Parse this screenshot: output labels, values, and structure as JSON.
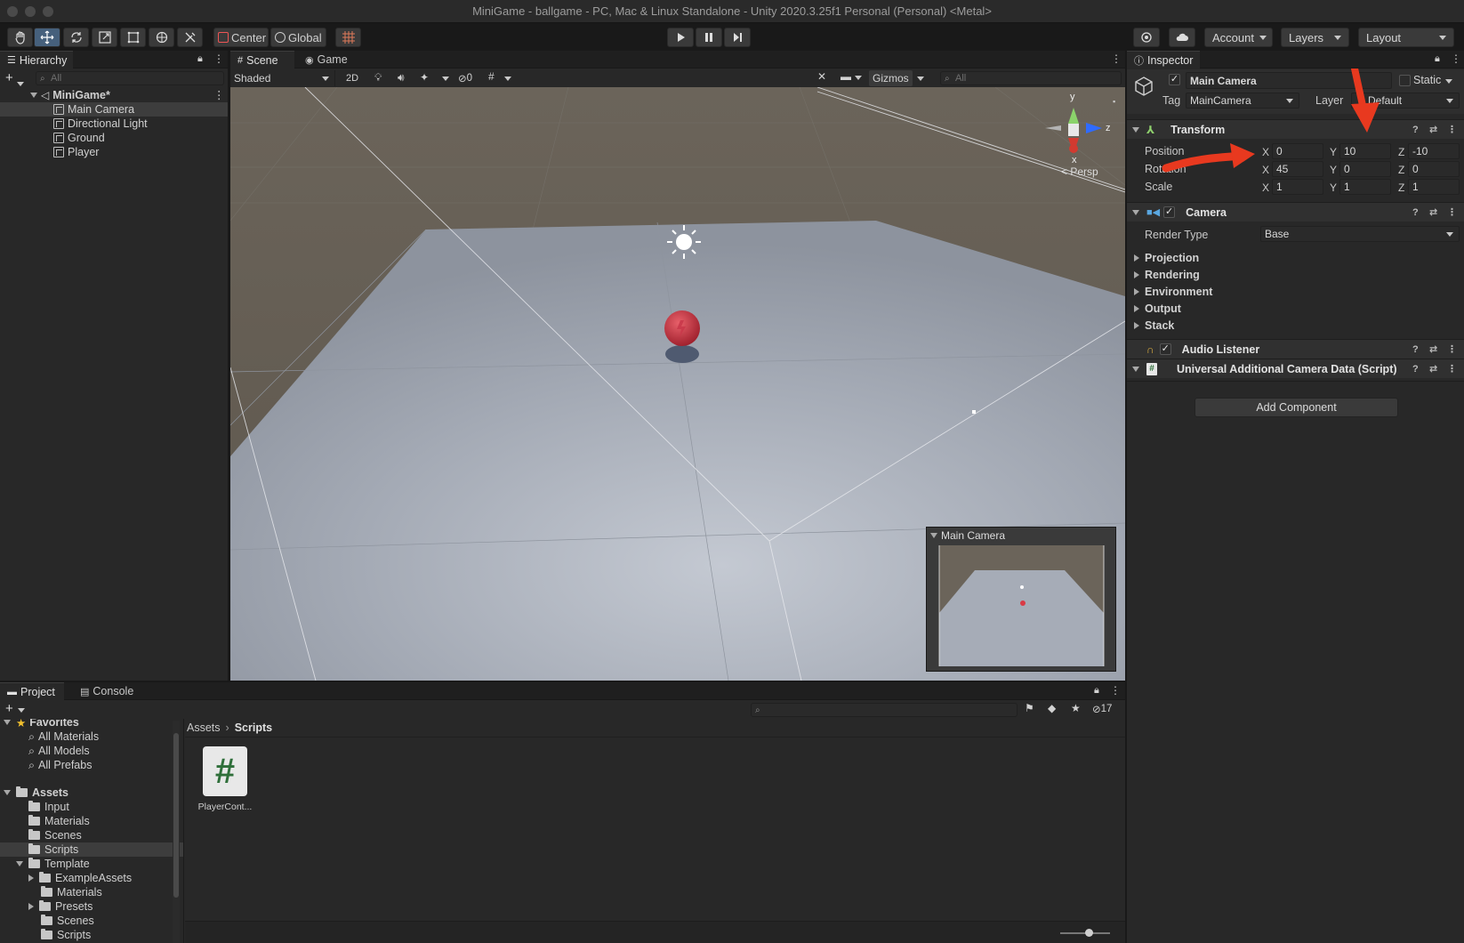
{
  "window": {
    "title": "MiniGame - ballgame - PC, Mac & Linux Standalone - Unity 2020.3.25f1 Personal (Personal) <Metal>"
  },
  "toolbar": {
    "pivot_label": "Center",
    "space_label": "Global",
    "account_label": "Account",
    "layers_label": "Layers",
    "layout_label": "Layout"
  },
  "hierarchy": {
    "tab_label": "Hierarchy",
    "search_placeholder": "All",
    "scene_name": "MiniGame*",
    "items": [
      {
        "label": "Main Camera"
      },
      {
        "label": "Directional Light"
      },
      {
        "label": "Ground"
      },
      {
        "label": "Player"
      }
    ]
  },
  "scene": {
    "tabs": [
      {
        "label": "Scene"
      },
      {
        "label": "Game"
      }
    ],
    "draw_mode": "Shaded",
    "mode_2d": "2D",
    "hidden_count": "0",
    "gizmos_label": "Gizmos",
    "search_placeholder": "All",
    "gizmo_axes": {
      "y": "y",
      "z": "z",
      "x": "x"
    },
    "persp_label": "Persp",
    "camera_preview_title": "Main Camera"
  },
  "inspector": {
    "tab_label": "Inspector",
    "object_name": "Main Camera",
    "static_label": "Static",
    "tag_label": "Tag",
    "tag_value": "MainCamera",
    "layer_label": "Layer",
    "layer_value": "Default",
    "transform": {
      "title": "Transform",
      "position_label": "Position",
      "rotation_label": "Rotation",
      "scale_label": "Scale",
      "axis_x": "X",
      "axis_y": "Y",
      "axis_z": "Z",
      "position": {
        "x": "0",
        "y": "10",
        "z": "-10"
      },
      "rotation": {
        "x": "45",
        "y": "0",
        "z": "0"
      },
      "scale": {
        "x": "1",
        "y": "1",
        "z": "1"
      }
    },
    "camera": {
      "title": "Camera",
      "render_type_label": "Render Type",
      "render_type_value": "Base",
      "sections": [
        {
          "label": "Projection"
        },
        {
          "label": "Rendering"
        },
        {
          "label": "Environment"
        },
        {
          "label": "Output"
        },
        {
          "label": "Stack"
        }
      ]
    },
    "audio_listener": {
      "title": "Audio Listener"
    },
    "urp_data": {
      "title": "Universal Additional Camera Data (Script)"
    },
    "add_component_label": "Add Component"
  },
  "project": {
    "tabs": [
      {
        "label": "Project"
      },
      {
        "label": "Console"
      }
    ],
    "hidden_count": "17",
    "favorites_label": "Favorites",
    "favorites": [
      {
        "label": "All Materials"
      },
      {
        "label": "All Models"
      },
      {
        "label": "All Prefabs"
      }
    ],
    "assets_label": "Assets",
    "asset_folders": [
      {
        "label": "Input"
      },
      {
        "label": "Materials"
      },
      {
        "label": "Scenes"
      },
      {
        "label": "Scripts"
      }
    ],
    "template_label": "Template",
    "template_children": [
      {
        "label": "ExampleAssets"
      },
      {
        "label": "Materials"
      },
      {
        "label": "Presets"
      },
      {
        "label": "Scenes"
      },
      {
        "label": "Scripts"
      }
    ],
    "breadcrumb": {
      "root": "Assets",
      "current": "Scripts"
    },
    "files": [
      {
        "name": "PlayerCont...",
        "glyph": "#"
      }
    ]
  },
  "colors": {
    "accent_arrow": "#e8391f",
    "script_green": "#2f6f3a",
    "selected": "#46607c"
  }
}
